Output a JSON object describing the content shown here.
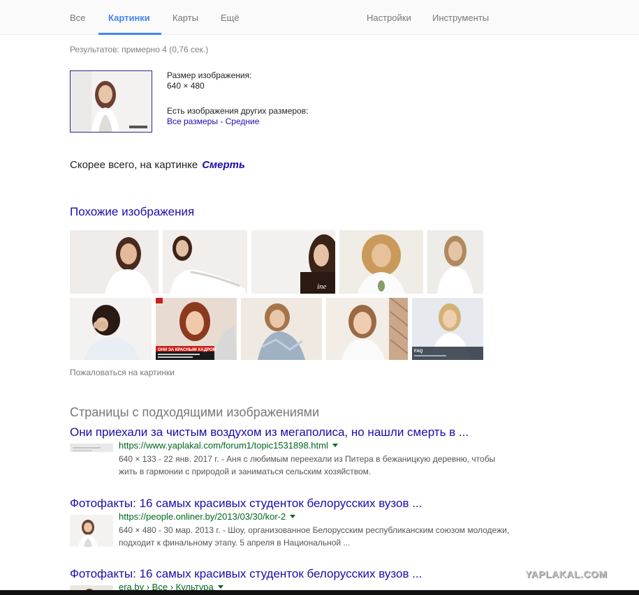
{
  "nav": {
    "tabs": [
      "Все",
      "Картинки",
      "Карты",
      "Ещё"
    ],
    "active_tab": "Картинки",
    "settings": "Настройки",
    "tools": "Инструменты"
  },
  "stats": "Результатов: примерно 4 (0,76 сек.)",
  "query_image": {
    "size_label": "Размер изображения:",
    "size_value": "640 × 480",
    "other_sizes_label": "Есть изображения других размеров:",
    "all_sizes_link": "Все размеры",
    "separator": " - ",
    "medium_link": "Средние"
  },
  "best_guess": {
    "prefix": "Скорее всего, на картинке",
    "link": "Смерть"
  },
  "similar": {
    "title": "Похожие изображения",
    "report": "Пожаловаться на картинки",
    "thumb_text_2_3": "ine",
    "thumb_text_6_2": "ОНИ ЗА КРАСНЫМ ХАДРОМ",
    "thumb_text_6_5": "FAQ"
  },
  "pages": {
    "title": "Страницы с подходящими изображениями",
    "results": [
      {
        "title": "Они приехали за чистым воздухом из мегаполиса, но нашли смерть в ...",
        "url": "https://www.yaplakal.com/forum1/topic1531898.html",
        "snippet": "640 × 133 - 22 янв. 2017 г. - Аня с любимым переехали из Питера в бежаницкую деревню, чтобы жить в гармонии с природой и заниматься сельским хозяйством."
      },
      {
        "title": "Фотофакты: 16 самых красивых студенток белорусских вузов ...",
        "url": "https://people.onliner.by/2013/03/30/kor-2",
        "snippet": "640 × 480 - 30 мар. 2013 г. - Шоу, организованное Белорусским республиканским союзом молодежи, подходит к финальному этапу. 5 апреля в Национальной ..."
      },
      {
        "title": "Фотофакты: 16 самых красивых студенток белорусских вузов ...",
        "url": "era.by › Все › Культура",
        "snippet": ""
      }
    ]
  },
  "watermark": "YAPLAKAL.COM",
  "colors": {
    "link": "#1a0dab",
    "url": "#006621",
    "active_tab": "#4285f4",
    "snippet": "#545454"
  }
}
